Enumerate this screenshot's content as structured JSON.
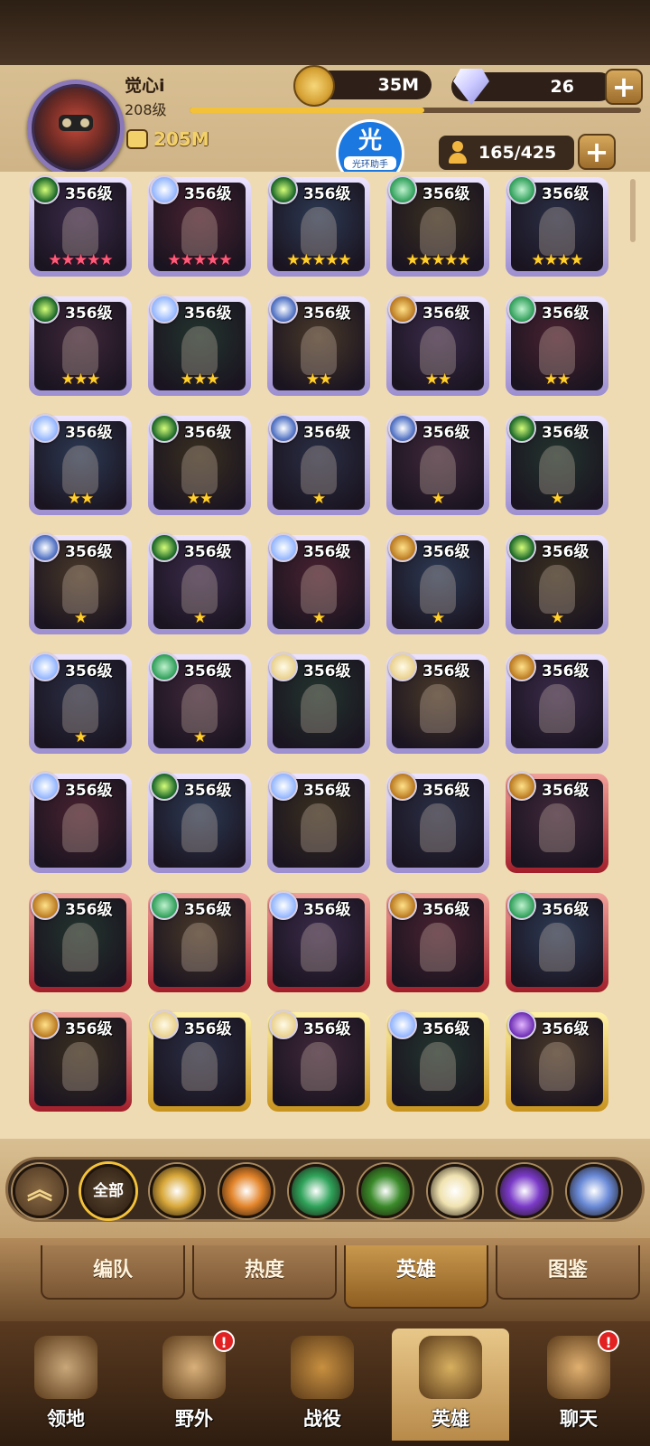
{
  "player": {
    "name": "觉心i",
    "level": "208级",
    "power": "205M",
    "xp_fraction": 0.52
  },
  "resources": {
    "gold": "35M",
    "gems": "26",
    "roster": "165/425"
  },
  "watermark": {
    "symbol": "光",
    "label": "光环助手"
  },
  "heroes": [
    {
      "level": "356级",
      "frame": "purple",
      "faction": "grave",
      "stars": "★★★★★",
      "star_color": "pink"
    },
    {
      "level": "356级",
      "frame": "purple",
      "faction": "light",
      "stars": "★★★★★",
      "star_color": "pink"
    },
    {
      "level": "356级",
      "frame": "purple",
      "faction": "grave",
      "stars": "★★★★★",
      "star_color": "gold"
    },
    {
      "level": "356级",
      "frame": "purple",
      "faction": "wilder",
      "stars": "★★★★★",
      "star_color": "gold"
    },
    {
      "level": "356级",
      "frame": "purple",
      "faction": "wilder",
      "stars": "★★★★",
      "star_color": "gold"
    },
    {
      "level": "356级",
      "frame": "purple",
      "faction": "grave",
      "stars": "★★★",
      "star_color": "gold"
    },
    {
      "level": "356级",
      "frame": "purple",
      "faction": "light",
      "stars": "★★★",
      "star_color": "gold"
    },
    {
      "level": "356级",
      "frame": "purple",
      "faction": "dimen",
      "stars": "★★",
      "star_color": "gold"
    },
    {
      "level": "356级",
      "frame": "purple",
      "faction": "mauler",
      "stars": "★★",
      "star_color": "gold"
    },
    {
      "level": "356级",
      "frame": "purple",
      "faction": "wilder",
      "stars": "★★",
      "star_color": "gold"
    },
    {
      "level": "356级",
      "frame": "purple",
      "faction": "light",
      "stars": "★★",
      "star_color": "gold"
    },
    {
      "level": "356级",
      "frame": "purple",
      "faction": "grave",
      "stars": "★★",
      "star_color": "gold"
    },
    {
      "level": "356级",
      "frame": "purple",
      "faction": "dimen",
      "stars": "★",
      "star_color": "gold"
    },
    {
      "level": "356级",
      "frame": "purple",
      "faction": "dimen",
      "stars": "★",
      "star_color": "gold"
    },
    {
      "level": "356级",
      "frame": "purple",
      "faction": "grave",
      "stars": "★",
      "star_color": "gold"
    },
    {
      "level": "356级",
      "frame": "purple",
      "faction": "dimen",
      "stars": "★",
      "star_color": "gold"
    },
    {
      "level": "356级",
      "frame": "purple",
      "faction": "grave",
      "stars": "★",
      "star_color": "gold"
    },
    {
      "level": "356级",
      "frame": "purple",
      "faction": "light",
      "stars": "★",
      "star_color": "gold"
    },
    {
      "level": "356级",
      "frame": "purple",
      "faction": "mauler",
      "stars": "★",
      "star_color": "gold"
    },
    {
      "level": "356级",
      "frame": "purple",
      "faction": "grave",
      "stars": "★",
      "star_color": "gold"
    },
    {
      "level": "356级",
      "frame": "purple",
      "faction": "light",
      "stars": "★",
      "star_color": "gold"
    },
    {
      "level": "356级",
      "frame": "purple",
      "faction": "wilder",
      "stars": "★",
      "star_color": "gold"
    },
    {
      "level": "356级",
      "frame": "purple",
      "faction": "celest",
      "stars": "",
      "star_color": "gold"
    },
    {
      "level": "356级",
      "frame": "purple",
      "faction": "celest",
      "stars": "",
      "star_color": "gold"
    },
    {
      "level": "356级",
      "frame": "purple",
      "faction": "mauler",
      "stars": "",
      "star_color": "gold"
    },
    {
      "level": "356级",
      "frame": "purple",
      "faction": "light",
      "stars": "",
      "star_color": "gold"
    },
    {
      "level": "356级",
      "frame": "purple",
      "faction": "grave",
      "stars": "",
      "star_color": "gold"
    },
    {
      "level": "356级",
      "frame": "purple",
      "faction": "light",
      "stars": "",
      "star_color": "gold"
    },
    {
      "level": "356级",
      "frame": "purple",
      "faction": "mauler",
      "stars": "",
      "star_color": "gold"
    },
    {
      "level": "356级",
      "frame": "red",
      "faction": "mauler",
      "stars": "",
      "star_color": "gold"
    },
    {
      "level": "356级",
      "frame": "red",
      "faction": "mauler",
      "stars": "",
      "star_color": "gold"
    },
    {
      "level": "356级",
      "frame": "red",
      "faction": "wilder",
      "stars": "",
      "star_color": "gold"
    },
    {
      "level": "356级",
      "frame": "red",
      "faction": "light",
      "stars": "",
      "star_color": "gold"
    },
    {
      "level": "356级",
      "frame": "red",
      "faction": "mauler",
      "stars": "",
      "star_color": "gold"
    },
    {
      "level": "356级",
      "frame": "red",
      "faction": "wilder",
      "stars": "",
      "star_color": "gold"
    },
    {
      "level": "356级",
      "frame": "red",
      "faction": "mauler",
      "stars": "",
      "star_color": "gold"
    },
    {
      "level": "356级",
      "frame": "gold",
      "faction": "celest",
      "stars": "",
      "star_color": "gold"
    },
    {
      "level": "356级",
      "frame": "gold",
      "faction": "celest",
      "stars": "",
      "star_color": "gold"
    },
    {
      "level": "356级",
      "frame": "gold",
      "faction": "light",
      "stars": "",
      "star_color": "gold"
    },
    {
      "level": "356级",
      "frame": "gold",
      "faction": "hypo",
      "stars": "",
      "star_color": "gold"
    }
  ],
  "filters": [
    {
      "name": "faction-lightbearer-filter",
      "icon": "lightbearer-icon",
      "color": "#d9a83a"
    },
    {
      "name": "faction-mauler-filter",
      "icon": "mauler-icon",
      "color": "#e3842a"
    },
    {
      "name": "faction-wilder-filter",
      "icon": "wilder-icon",
      "color": "#2fa35a"
    },
    {
      "name": "faction-graveborn-filter",
      "icon": "graveborn-icon",
      "color": "#3a8a2a"
    },
    {
      "name": "faction-celestial-filter",
      "icon": "celestial-icon",
      "color": "#f0e2b0"
    },
    {
      "name": "faction-hypogean-filter",
      "icon": "hypogean-icon",
      "color": "#7a3ac8"
    },
    {
      "name": "faction-dimensional-filter",
      "icon": "dimensional-icon",
      "color": "#6a8ad8"
    }
  ],
  "filter_all_label": "全部",
  "tabs": [
    {
      "label": "编队",
      "active": false
    },
    {
      "label": "热度",
      "active": false
    },
    {
      "label": "英雄",
      "active": true
    },
    {
      "label": "图鉴",
      "active": false
    }
  ],
  "nav": [
    {
      "label": "领地",
      "icon": "castle-icon",
      "badge": "",
      "active": false
    },
    {
      "label": "野外",
      "icon": "scroll-map-icon",
      "badge": "!",
      "active": false
    },
    {
      "label": "战役",
      "icon": "sword-crest-icon",
      "badge": "",
      "active": false
    },
    {
      "label": "英雄",
      "icon": "helmet-icon",
      "badge": "",
      "active": true
    },
    {
      "label": "聊天",
      "icon": "chat-bubble-icon",
      "badge": "!",
      "active": false
    }
  ]
}
